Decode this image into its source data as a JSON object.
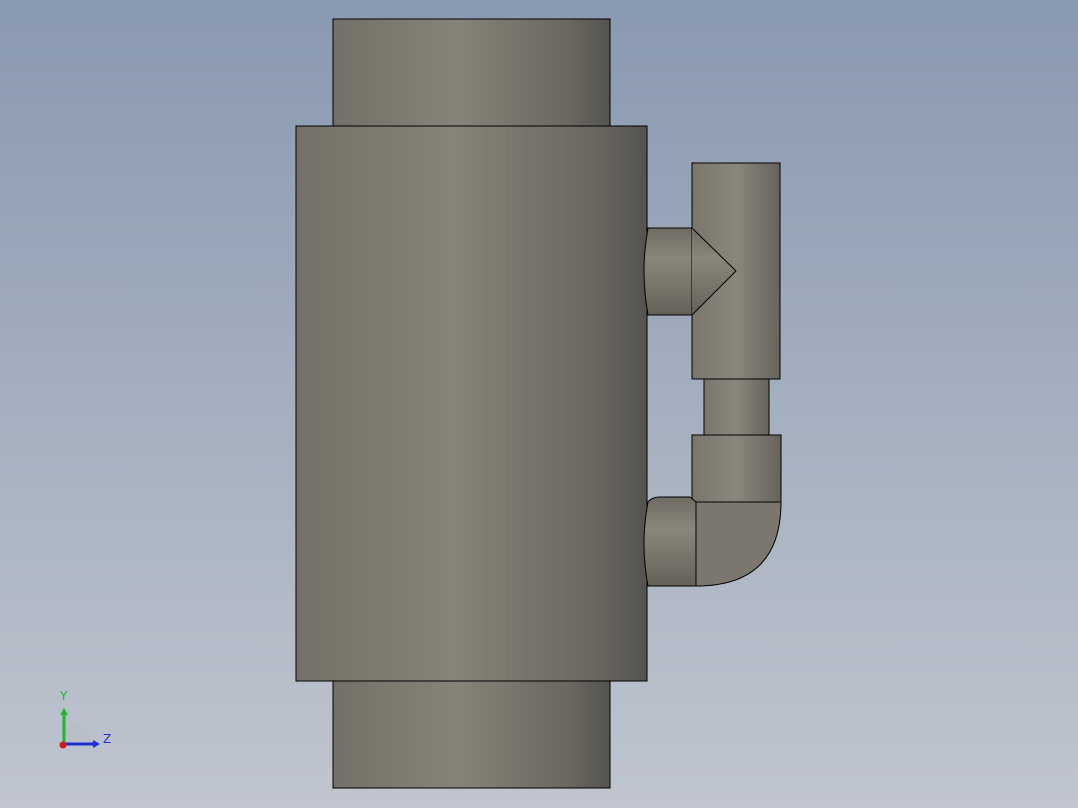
{
  "viewport": {
    "background_top": "#8999b0",
    "background_bottom": "#c0c5cf",
    "model_color_light": "#8a857a",
    "model_color_dark": "#5b5954",
    "edge_color": "#000000"
  },
  "triad": {
    "y_label": "Y",
    "z_label": "Z",
    "y_color": "#1fb82c",
    "z_color": "#1c2fd6",
    "x_color": "#d11a1a"
  }
}
